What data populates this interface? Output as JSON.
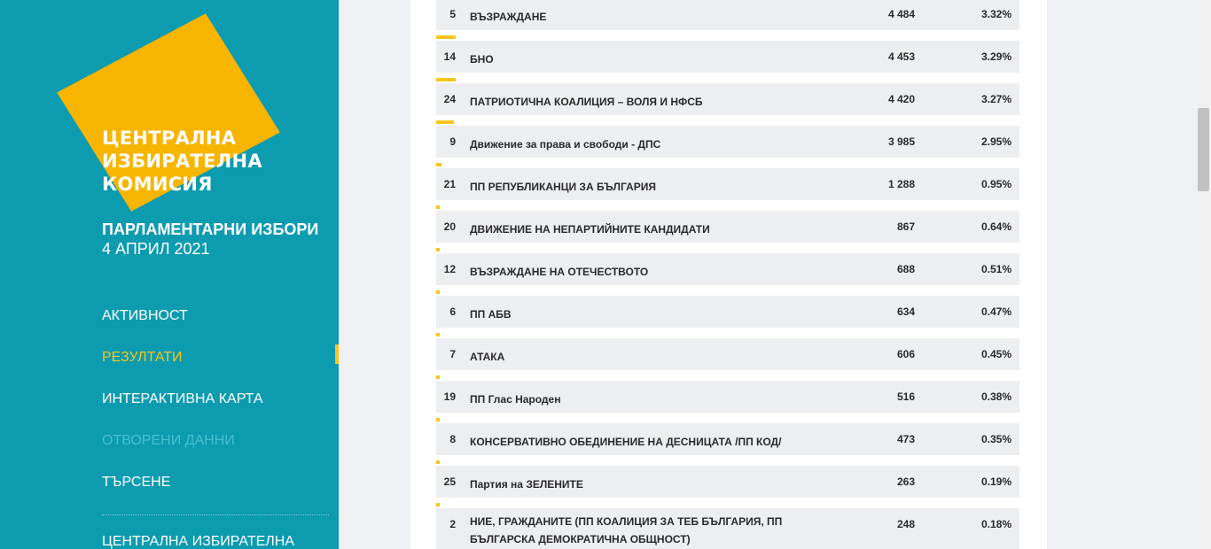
{
  "logo": {
    "line1": "ЦЕНТРАЛНА",
    "line2": "ИЗБИРАТЕЛНА",
    "line3": "КОМИСИЯ"
  },
  "election": {
    "title": "ПАРЛАМЕНТАРНИ ИЗБОРИ",
    "date": "4 АПРИЛ 2021"
  },
  "nav": {
    "items": [
      {
        "label": "АКТИВНОСТ"
      },
      {
        "label": "РЕЗУЛТАТИ"
      },
      {
        "label": "ИНТЕРАКТИВНА КАРТА"
      },
      {
        "label": "ОТВОРЕНИ ДАННИ"
      },
      {
        "label": "ТЪРСЕНЕ"
      },
      {
        "label": "ЦЕНТРАЛНА ИЗБИРАТЕЛНА"
      }
    ]
  },
  "colors": {
    "sidebar": "#0d9bb0",
    "accent": "#f7c51e",
    "logo": "#f7b500"
  },
  "results": [
    {
      "num": "5",
      "name": "ВЪЗРАЖДАНЕ",
      "votes": "4 484",
      "pct": "3.32%",
      "share": 3.32
    },
    {
      "num": "14",
      "name": "БНО",
      "votes": "4 453",
      "pct": "3.29%",
      "share": 3.29
    },
    {
      "num": "24",
      "name": "ПАТРИОТИЧНА КОАЛИЦИЯ – ВОЛЯ И НФСБ",
      "votes": "4 420",
      "pct": "3.27%",
      "share": 3.27
    },
    {
      "num": "9",
      "name": "Движение за права и свободи - ДПС",
      "votes": "3 985",
      "pct": "2.95%",
      "share": 2.95
    },
    {
      "num": "21",
      "name": "ПП РЕПУБЛИКАНЦИ ЗА БЪЛГАРИЯ",
      "votes": "1 288",
      "pct": "0.95%",
      "share": 0.95
    },
    {
      "num": "20",
      "name": "ДВИЖЕНИЕ НА НЕПАРТИЙНИТЕ КАНДИДАТИ",
      "votes": "867",
      "pct": "0.64%",
      "share": 0.64
    },
    {
      "num": "12",
      "name": "ВЪЗРАЖДАНЕ НА ОТЕЧЕСТВОТО",
      "votes": "688",
      "pct": "0.51%",
      "share": 0.51
    },
    {
      "num": "6",
      "name": "ПП АБВ",
      "votes": "634",
      "pct": "0.47%",
      "share": 0.47
    },
    {
      "num": "7",
      "name": "АТАКА",
      "votes": "606",
      "pct": "0.45%",
      "share": 0.45
    },
    {
      "num": "19",
      "name": "ПП Глас Народен",
      "votes": "516",
      "pct": "0.38%",
      "share": 0.38
    },
    {
      "num": "8",
      "name": "КОНСЕРВАТИВНО ОБЕДИНЕНИЕ НА ДЕСНИЦАТА /ПП КОД/",
      "votes": "473",
      "pct": "0.35%",
      "share": 0.35
    },
    {
      "num": "25",
      "name": "Партия на ЗЕЛЕНИТЕ",
      "votes": "263",
      "pct": "0.19%",
      "share": 0.19
    },
    {
      "num": "2",
      "name": "НИЕ, ГРАЖДАНИТЕ (ПП КОАЛИЦИЯ ЗА ТЕБ БЪЛГАРИЯ, ПП БЪЛГАРСКА ДЕМОКРАТИЧНА ОБЩНОСТ)",
      "votes": "248",
      "pct": "0.18%",
      "share": 0.18
    }
  ]
}
